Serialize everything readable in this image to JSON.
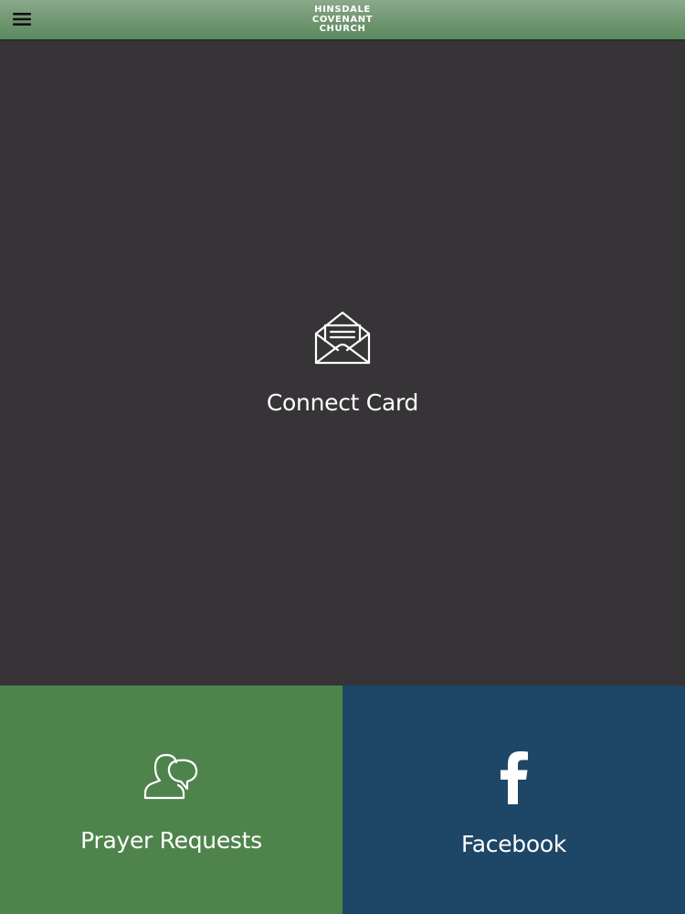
{
  "header": {
    "logo_line1": "HINSDALE",
    "logo_line2": "COVENANT",
    "logo_line3": "CHURCH",
    "menu_icon": "hamburger-menu-icon",
    "background_color": "#6f9670"
  },
  "tiles": {
    "connect_card": {
      "label": "Connect Card",
      "icon": "open-envelope-icon",
      "background_color": "#363436"
    },
    "prayer_requests": {
      "label": "Prayer Requests",
      "icon": "people-speech-icon",
      "background_color": "#4f834c"
    },
    "facebook": {
      "label": "Facebook",
      "icon": "facebook-icon",
      "background_color": "#1e4666"
    }
  }
}
